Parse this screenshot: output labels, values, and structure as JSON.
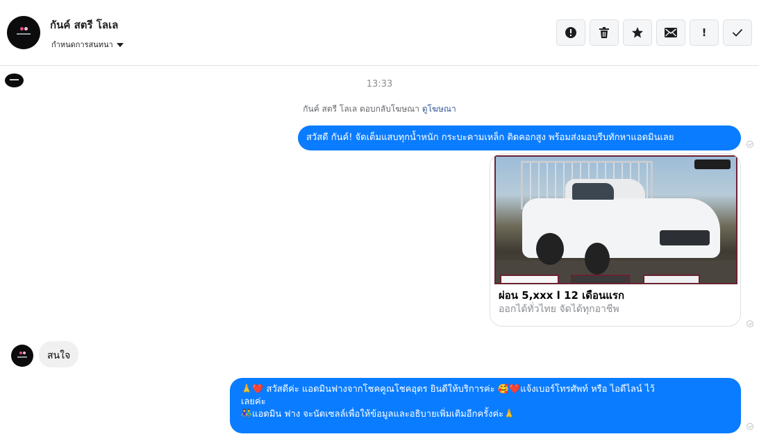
{
  "header": {
    "contact_name": "กันค์ สตรี โลเล",
    "assign_label": "กำหนดการสนทนา",
    "actions": [
      {
        "name": "alert-button",
        "icon": "alert-circle-icon"
      },
      {
        "name": "delete-button",
        "icon": "trash-icon"
      },
      {
        "name": "star-button",
        "icon": "star-icon"
      },
      {
        "name": "mark-unread-button",
        "icon": "envelope-icon"
      },
      {
        "name": "important-button",
        "icon": "exclamation-icon",
        "label": "!"
      },
      {
        "name": "done-button",
        "icon": "checkmark-icon"
      }
    ]
  },
  "thread": {
    "timestamp": "13:33",
    "ad_reply_text": "กันค์ สตรี โลเล ตอบกลับโฆษณา",
    "ad_reply_link": "ดูโฆษณา",
    "msg1": "สวัสดี กันค์! จัดเต็มแสบทุกน้ำหนัก กระบะคามเหล็ก ติดคอกสูง พร้อมส่งมอบรีบทักหาแอดมินเลย",
    "card": {
      "title": "ผ่อน 5,xxx l 12 เดือนแรก",
      "subtitle": "ออกได้ทั่วไทย จัดได้ทุกอาชีพ"
    },
    "reply": "สนใจ",
    "msg3_line1": "🙏❤️ สวัสดีค่ะ แอดมินฟางจากโชคคูณโชคอุดร ยินดีให้บริการค่ะ 🥰❤️แจ้งเบอร์โทรศัพท์ หรือ ไอดีไลน์  ไว้",
    "msg3_line2": "เลยค่ะ",
    "msg3_line3": "👫แอดมิน ฟาง จะนัดเซลล์เพื่อให้ข้อมูลและอธิบายเพิ่มเติมอีกครั้งค่ะ🙏"
  },
  "colors": {
    "outgoing_bubble": "#0a7cff",
    "incoming_bubble": "#f0f0f0",
    "link": "#385898"
  }
}
